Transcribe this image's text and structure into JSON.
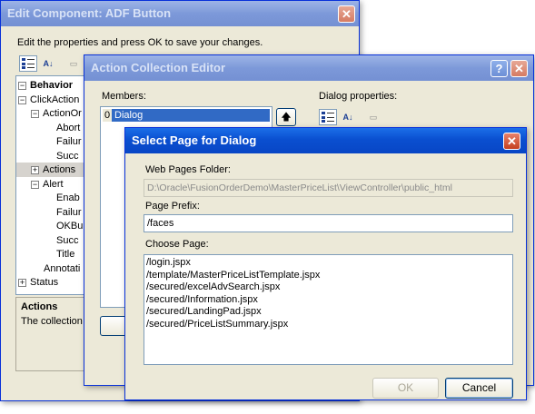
{
  "edit_component": {
    "title": "Edit Component: ADF Button",
    "instruction": "Edit the properties and press OK to save your changes.",
    "tree": [
      {
        "label": "Behavior",
        "bold": true,
        "pm": "-"
      },
      {
        "label": "ClickAction",
        "pm": "-"
      },
      {
        "label": "ActionOr",
        "pm": "-"
      },
      {
        "label": "Abort"
      },
      {
        "label": "Failur"
      },
      {
        "label": "Succ"
      },
      {
        "label": "Actions",
        "pm": "+"
      },
      {
        "label": "Alert",
        "pm": "-"
      },
      {
        "label": "Enab"
      },
      {
        "label": "Failur"
      },
      {
        "label": "OKBu"
      },
      {
        "label": "Succ"
      },
      {
        "label": "Title"
      },
      {
        "label": "Annotati"
      },
      {
        "label": "Status",
        "pm": "+"
      }
    ],
    "desc_title": "Actions",
    "desc_text": "The collection"
  },
  "action_collection": {
    "title": "Action Collection Editor",
    "members_label": "Members:",
    "member_index": "0",
    "member_name": "Dialog",
    "dialog_props_label": "Dialog properties:"
  },
  "select_page": {
    "title": "Select Page for Dialog",
    "folder_label": "Web Pages Folder:",
    "folder_value": "D:\\Oracle\\FusionOrderDemo\\MasterPriceList\\ViewController\\public_html",
    "prefix_label": "Page Prefix:",
    "prefix_value": "/faces",
    "choose_label": "Choose Page:",
    "pages": [
      "/login.jspx",
      "/template/MasterPriceListTemplate.jspx",
      "/secured/excelAdvSearch.jspx",
      "/secured/Information.jspx",
      "/secured/LandingPad.jspx",
      "/secured/PriceListSummary.jspx"
    ],
    "ok_label": "OK",
    "cancel_label": "Cancel"
  },
  "colors": {
    "title_active": "#0a4fd0",
    "title_inactive": "#7d99d9",
    "selection": "#316ac5",
    "dialog_bg": "#ece9d8"
  }
}
